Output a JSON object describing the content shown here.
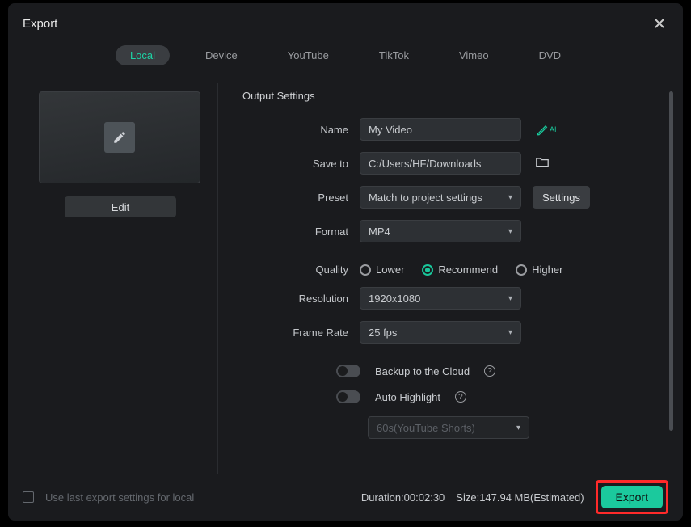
{
  "title": "Export",
  "tabs": [
    "Local",
    "Device",
    "YouTube",
    "TikTok",
    "Vimeo",
    "DVD"
  ],
  "active_tab": 0,
  "edit_label": "Edit",
  "section_title": "Output Settings",
  "labels": {
    "name": "Name",
    "save_to": "Save to",
    "preset": "Preset",
    "format": "Format",
    "quality": "Quality",
    "resolution": "Resolution",
    "frame_rate": "Frame Rate"
  },
  "values": {
    "name": "My Video",
    "save_to": "C:/Users/HF/Downloads",
    "preset": "Match to project settings",
    "format": "MP4",
    "resolution": "1920x1080",
    "frame_rate": "25 fps",
    "highlight_preset": "60s(YouTube Shorts)"
  },
  "ai_suffix": "AI",
  "settings_btn": "Settings",
  "quality_options": [
    "Lower",
    "Recommend",
    "Higher"
  ],
  "quality_selected": 1,
  "toggles": {
    "backup": "Backup to the Cloud",
    "auto_highlight": "Auto Highlight"
  },
  "footer": {
    "checkbox_label": "Use last export settings for local",
    "duration_label": "Duration:",
    "duration_value": "00:02:30",
    "size_label": "Size:",
    "size_value": "147.94 MB(Estimated)",
    "export_btn": "Export"
  }
}
